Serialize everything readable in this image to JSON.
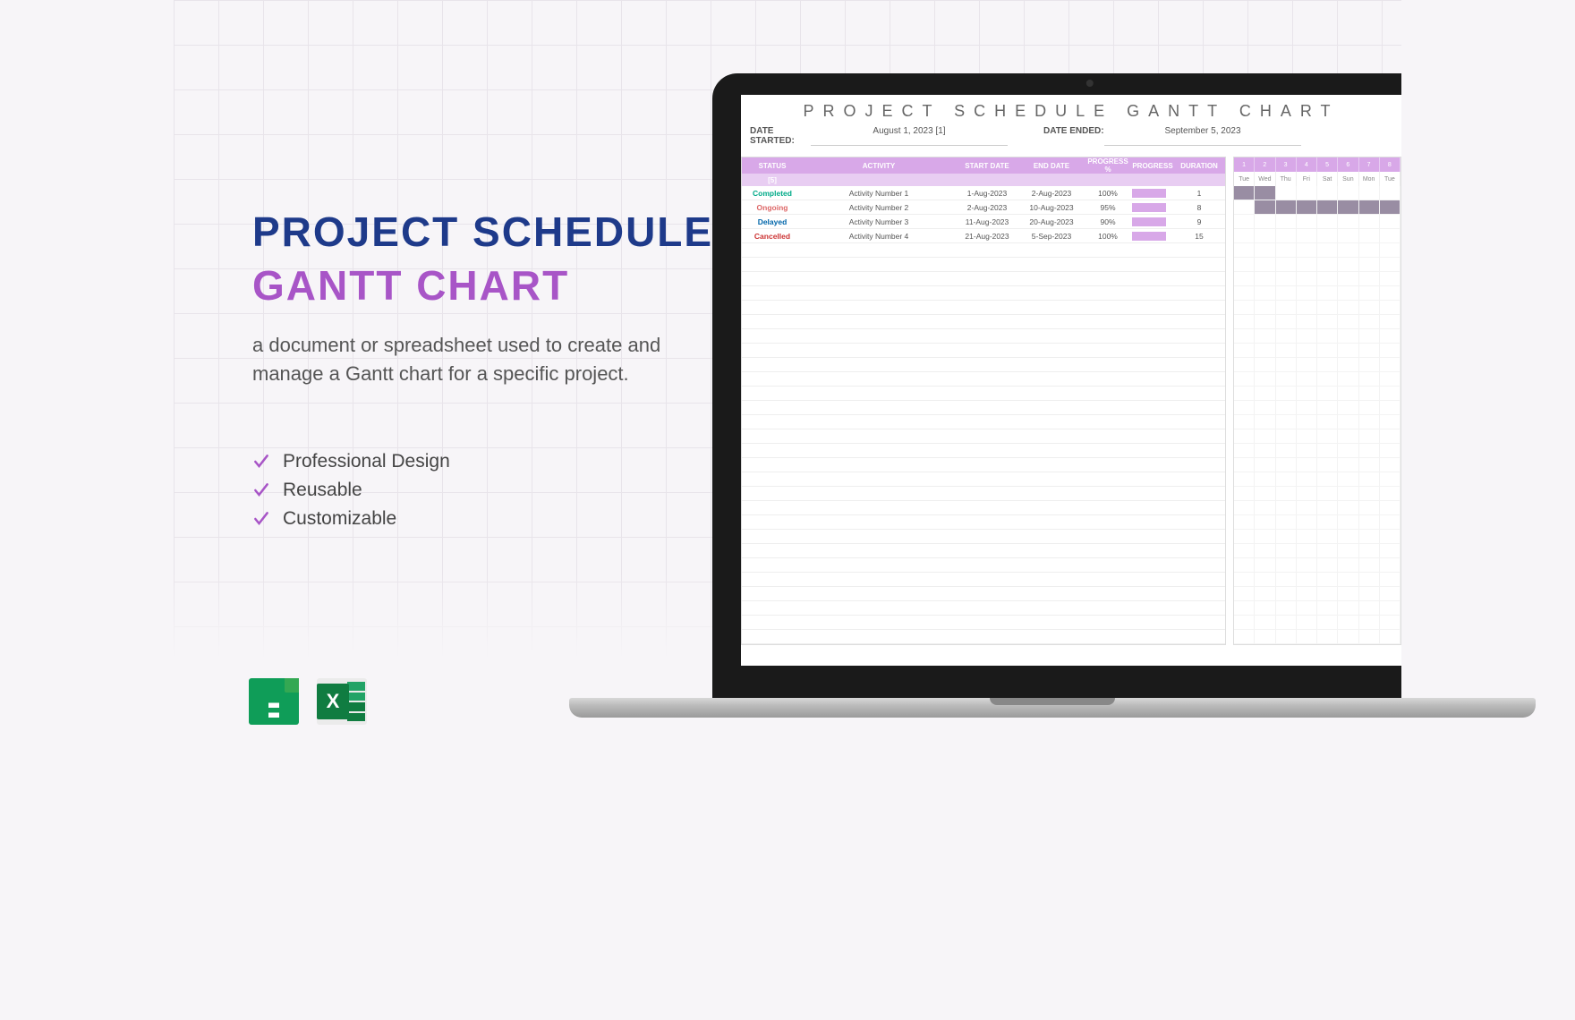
{
  "left": {
    "title1": "PROJECT SCHEDULE",
    "title2": "GANTT CHART",
    "description": "a document or spreadsheet used to create and manage a Gantt chart for a specific project.",
    "features": [
      "Professional Design",
      "Reusable",
      "Customizable"
    ]
  },
  "screen": {
    "heading": "PROJECT SCHEDULE GANTT CHART",
    "dateStartedLabel": "DATE STARTED:",
    "dateStarted": "August 1, 2023 [1]",
    "dateEndedLabel": "DATE ENDED:",
    "dateEnded": "September 5, 2023",
    "headers": {
      "status": "STATUS",
      "activity": "ACTIVITY",
      "startDate": "START DATE",
      "endDate": "END DATE",
      "progressPct": "PROGRESS %",
      "progress": "PROGRESS",
      "duration": "DURATION"
    },
    "subheader": "[5]",
    "rows": [
      {
        "status": "Completed",
        "cls": "st-completed",
        "activity": "Activity Number 1",
        "start": "1-Aug-2023",
        "end": "2-Aug-2023",
        "pct": "100%",
        "dur": "1"
      },
      {
        "status": "Ongoing",
        "cls": "st-ongoing",
        "activity": "Activity Number 2",
        "start": "2-Aug-2023",
        "end": "10-Aug-2023",
        "pct": "95%",
        "dur": "8"
      },
      {
        "status": "Delayed",
        "cls": "st-delayed",
        "activity": "Activity Number 3",
        "start": "11-Aug-2023",
        "end": "20-Aug-2023",
        "pct": "90%",
        "dur": "9"
      },
      {
        "status": "Cancelled",
        "cls": "st-cancelled",
        "activity": "Activity Number 4",
        "start": "21-Aug-2023",
        "end": "5-Sep-2023",
        "pct": "100%",
        "dur": "15"
      }
    ],
    "gantt": {
      "nums": [
        "1",
        "2",
        "3",
        "4",
        "5",
        "6",
        "7",
        "8"
      ],
      "days": [
        "Tue",
        "Wed",
        "Thu",
        "Fri",
        "Sat",
        "Sun",
        "Mon",
        "Tue"
      ],
      "bars": [
        [
          1,
          1,
          0,
          0,
          0,
          0,
          0,
          0
        ],
        [
          0,
          1,
          1,
          1,
          1,
          1,
          1,
          1
        ],
        [
          0,
          0,
          0,
          0,
          0,
          0,
          0,
          0
        ],
        [
          0,
          0,
          0,
          0,
          0,
          0,
          0,
          0
        ]
      ]
    }
  },
  "chart_data": {
    "type": "gantt",
    "title": "Project Schedule Gantt Chart",
    "date_started": "2023-08-01",
    "date_ended": "2023-09-05",
    "tasks": [
      {
        "status": "Completed",
        "activity": "Activity Number 1",
        "start": "2023-08-01",
        "end": "2023-08-02",
        "progress_pct": 100,
        "duration_days": 1
      },
      {
        "status": "Ongoing",
        "activity": "Activity Number 2",
        "start": "2023-08-02",
        "end": "2023-08-10",
        "progress_pct": 95,
        "duration_days": 8
      },
      {
        "status": "Delayed",
        "activity": "Activity Number 3",
        "start": "2023-08-11",
        "end": "2023-08-20",
        "progress_pct": 90,
        "duration_days": 9
      },
      {
        "status": "Cancelled",
        "activity": "Activity Number 4",
        "start": "2023-08-21",
        "end": "2023-09-05",
        "progress_pct": 100,
        "duration_days": 15
      }
    ],
    "timeline_columns": [
      {
        "day": 1,
        "weekday": "Tue"
      },
      {
        "day": 2,
        "weekday": "Wed"
      },
      {
        "day": 3,
        "weekday": "Thu"
      },
      {
        "day": 4,
        "weekday": "Fri"
      },
      {
        "day": 5,
        "weekday": "Sat"
      },
      {
        "day": 6,
        "weekday": "Sun"
      },
      {
        "day": 7,
        "weekday": "Mon"
      },
      {
        "day": 8,
        "weekday": "Tue"
      }
    ]
  }
}
